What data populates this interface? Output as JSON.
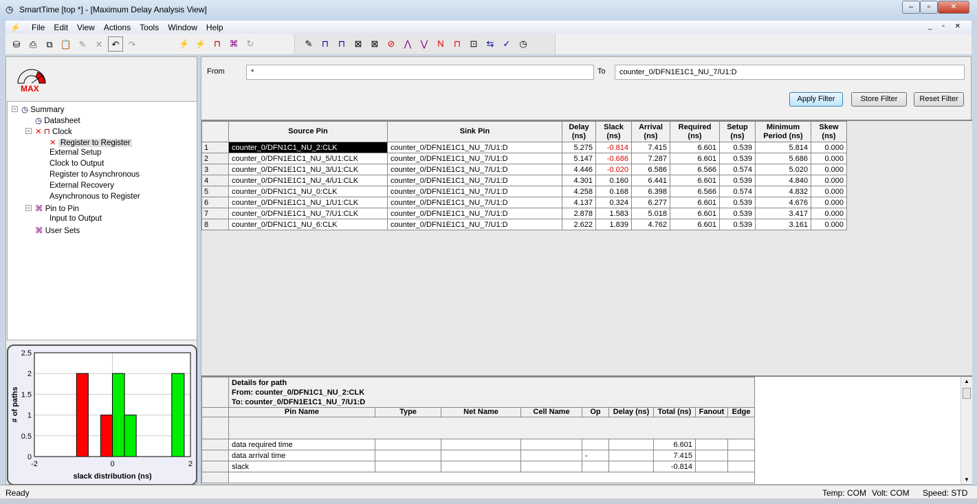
{
  "window": {
    "title": "SmartTime [top *] - [Maximum Delay Analysis View]"
  },
  "menu": [
    "File",
    "Edit",
    "View",
    "Actions",
    "Tools",
    "Window",
    "Help"
  ],
  "logo": {
    "text": "MAX"
  },
  "tree": [
    {
      "label": "Summary",
      "level": 0,
      "icon": "summary-icon"
    },
    {
      "label": "Datasheet",
      "level": 1,
      "icon": "datasheet-icon"
    },
    {
      "label": "Clock",
      "level": 1,
      "icon": "clock-icon",
      "error": true
    },
    {
      "label": "Register to Register",
      "level": 2,
      "error": true,
      "selected": true
    },
    {
      "label": "External Setup",
      "level": 2
    },
    {
      "label": "Clock to Output",
      "level": 2
    },
    {
      "label": "Register to Asynchronous",
      "level": 2
    },
    {
      "label": "External Recovery",
      "level": 2
    },
    {
      "label": "Asynchronous to Register",
      "level": 2
    },
    {
      "label": "Pin to Pin",
      "level": 1,
      "icon": "pin-to-pin-icon"
    },
    {
      "label": "Input to Output",
      "level": 2
    },
    {
      "label": "User Sets",
      "level": 1,
      "icon": "user-sets-icon"
    }
  ],
  "filter": {
    "from_label": "From",
    "from_value": "*",
    "to_label": "To",
    "to_value": "counter_0/DFN1E1C1_NU_7/U1:D",
    "apply": "Apply Filter",
    "store": "Store Filter",
    "reset": "Reset Filter"
  },
  "paths": {
    "columns": [
      "",
      "Source Pin",
      "Sink Pin",
      "Delay\n(ns)",
      "Slack\n(ns)",
      "Arrival\n(ns)",
      "Required\n(ns)",
      "Setup\n(ns)",
      "Minimum\nPeriod (ns)",
      "Skew\n(ns)"
    ],
    "rows": [
      [
        "1",
        "counter_0/DFN1C1_NU_2:CLK",
        "counter_0/DFN1E1C1_NU_7/U1:D",
        "5.275",
        "-0.814",
        "7.415",
        "6.601",
        "0.539",
        "5.814",
        "0.000"
      ],
      [
        "2",
        "counter_0/DFN1E1C1_NU_5/U1:CLK",
        "counter_0/DFN1E1C1_NU_7/U1:D",
        "5.147",
        "-0.686",
        "7.287",
        "6.601",
        "0.539",
        "5.686",
        "0.000"
      ],
      [
        "3",
        "counter_0/DFN1E1C1_NU_3/U1:CLK",
        "counter_0/DFN1E1C1_NU_7/U1:D",
        "4.446",
        "-0.020",
        "6.586",
        "6.566",
        "0.574",
        "5.020",
        "0.000"
      ],
      [
        "4",
        "counter_0/DFN1E1C1_NU_4/U1:CLK",
        "counter_0/DFN1E1C1_NU_7/U1:D",
        "4.301",
        "0.160",
        "6.441",
        "6.601",
        "0.539",
        "4.840",
        "0.000"
      ],
      [
        "5",
        "counter_0/DFN1C1_NU_0:CLK",
        "counter_0/DFN1E1C1_NU_7/U1:D",
        "4.258",
        "0.168",
        "6.398",
        "6.566",
        "0.574",
        "4.832",
        "0.000"
      ],
      [
        "6",
        "counter_0/DFN1E1C1_NU_1/U1:CLK",
        "counter_0/DFN1E1C1_NU_7/U1:D",
        "4.137",
        "0.324",
        "6.277",
        "6.601",
        "0.539",
        "4.676",
        "0.000"
      ],
      [
        "7",
        "counter_0/DFN1E1C1_NU_7/U1:CLK",
        "counter_0/DFN1E1C1_NU_7/U1:D",
        "2.878",
        "1.583",
        "5.018",
        "6.601",
        "0.539",
        "3.417",
        "0.000"
      ],
      [
        "8",
        "counter_0/DFN1C1_NU_6:CLK",
        "counter_0/DFN1E1C1_NU_7/U1:D",
        "2.622",
        "1.839",
        "4.762",
        "6.601",
        "0.539",
        "3.161",
        "0.000"
      ]
    ]
  },
  "details": {
    "title": "Details for path",
    "from": "From: counter_0/DFN1C1_NU_2:CLK",
    "to": "To: counter_0/DFN1E1C1_NU_7/U1:D",
    "columns": [
      "",
      "Pin Name",
      "Type",
      "Net Name",
      "Cell Name",
      "Op",
      "Delay (ns)",
      "Total (ns)",
      "Fanout",
      "Edge"
    ],
    "rows": [
      [
        "",
        "data required time",
        "",
        "",
        "",
        "",
        "",
        "6.601",
        "",
        ""
      ],
      [
        "",
        "data arrival time",
        "",
        "",
        "",
        "-",
        "",
        "7.415",
        "",
        ""
      ],
      [
        "",
        "slack",
        "",
        "",
        "",
        "",
        "",
        "-0.814",
        "",
        ""
      ]
    ]
  },
  "status": {
    "left": "Ready",
    "temp": "Temp: COM",
    "volt": "Volt: COM",
    "speed": "Speed: STD"
  },
  "chart_data": {
    "type": "bar",
    "xlabel": "slack distribution (ns)",
    "ylabel": "# of paths",
    "xlim": [
      -2,
      2
    ],
    "ylim": [
      0,
      2.5
    ],
    "xticks": [
      "-2",
      "0",
      "2"
    ],
    "yticks": [
      "0",
      "0.5",
      "1",
      "1.5",
      "2",
      "2.5"
    ],
    "grid": true,
    "bins": [
      {
        "x0": -0.92,
        "x1": -0.62,
        "count": 2,
        "color": "#ff0000"
      },
      {
        "x0": -0.3,
        "x1": 0.0,
        "count": 1,
        "color": "#ff0000"
      },
      {
        "x0": 0.0,
        "x1": 0.31,
        "count": 2,
        "color": "#00ee00"
      },
      {
        "x0": 0.31,
        "x1": 0.61,
        "count": 1,
        "color": "#00ee00"
      },
      {
        "x0": 1.52,
        "x1": 1.84,
        "count": 2,
        "color": "#00ee00"
      }
    ]
  }
}
